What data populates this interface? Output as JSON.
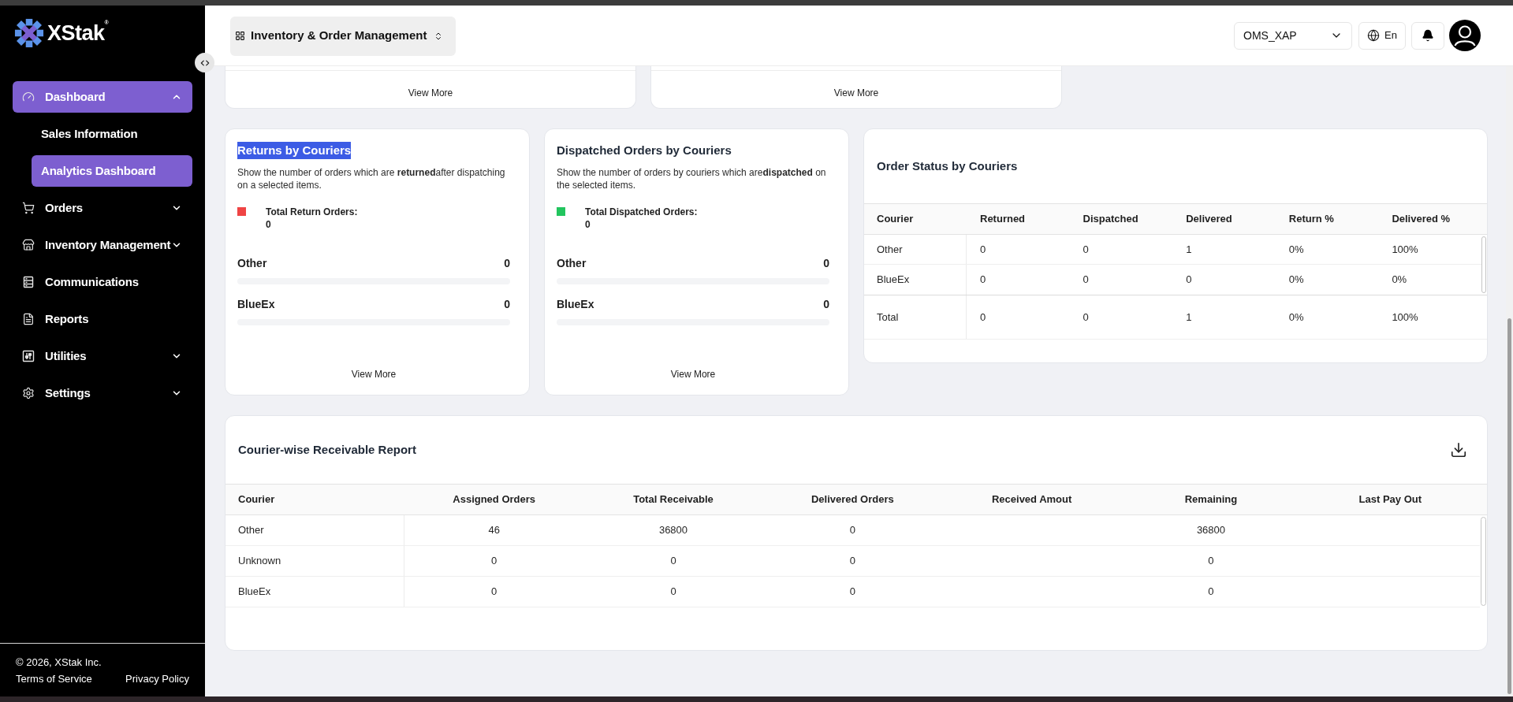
{
  "sidebar": {
    "logo": "XStak$^{®}$",
    "items": [
      {
        "kind": "group",
        "label": "Dashboard",
        "selected": true,
        "expanded": true,
        "children": [
          {
            "label": "Sales Information",
            "selected": false
          },
          {
            "label": "Analytics Dashboard",
            "selected": true
          }
        ]
      },
      {
        "kind": "group",
        "label": "Orders",
        "selected": false,
        "expanded": false
      },
      {
        "kind": "group",
        "label": "Inventory Management",
        "selected": false,
        "expanded": false
      },
      {
        "kind": "link",
        "label": "Communications",
        "selected": false
      },
      {
        "kind": "link",
        "label": "Reports",
        "selected": false
      },
      {
        "kind": "group",
        "label": "Utilities",
        "selected": false,
        "expanded": false
      },
      {
        "kind": "group",
        "label": "Settings",
        "selected": false,
        "expanded": false
      }
    ],
    "footer": {
      "copyright": "© 2026, XStak Inc.",
      "links": [
        "Terms of Service",
        "Privacy Policy"
      ]
    }
  },
  "header": {
    "app_switcher": "Inventory & Order Management",
    "store_select": "OMS_XAP",
    "language": "En"
  },
  "top_cards": [
    {
      "link": "View More"
    },
    {
      "link": "View More"
    }
  ],
  "courier_cards": [
    {
      "title": "Returns by Couriers",
      "title_highlighted": true,
      "description": "Show the number of orders which are **returned**after dispatching on a selected items.",
      "legend": {
        "label": "Total Return Orders:",
        "value": "0",
        "color": "#ef4444"
      },
      "rows": [
        {
          "name": "Other",
          "value": "0",
          "level": 0
        },
        {
          "name": "BlueEx",
          "value": "0",
          "level": 0
        }
      ],
      "link": "View More"
    },
    {
      "title": "Dispatched Orders by Couriers",
      "title_highlighted": false,
      "description": "Show the number of orders by couriers which are**dispatched** on the selected items.",
      "legend": {
        "label": "Total Dispatched Orders:",
        "value": "0",
        "color": "#22c55e"
      },
      "rows": [
        {
          "name": "Other",
          "value": "0",
          "level": 0
        },
        {
          "name": "BlueEx",
          "value": "0",
          "level": 0
        }
      ],
      "link": "View More"
    }
  ],
  "order_status": {
    "title": "Order Status by Couriers",
    "columns": [
      "Courier",
      "Returned",
      "Dispatched",
      "Delivered",
      "Return %",
      "Delivered %"
    ],
    "rows": [
      [
        "Other",
        "0",
        "0",
        "1",
        "0%",
        "100%"
      ],
      [
        "BlueEx",
        "0",
        "0",
        "0",
        "0%",
        "0%"
      ]
    ],
    "total": [
      "Total",
      "0",
      "0",
      "1",
      "0%",
      "100%"
    ]
  },
  "receivable_report": {
    "title": "Courier-wise Receivable Report",
    "columns": [
      "Courier",
      "Assigned Orders",
      "Total Receivable",
      "Delivered Orders",
      "Received Amout",
      "Remaining",
      "Last Pay Out"
    ],
    "rows": [
      {
        "courier": "Other",
        "assigned_orders": "46",
        "total_receivable": "36800",
        "delivered_orders": "0",
        "remaining": "36800"
      },
      {
        "courier": "Unknown",
        "assigned_orders": "0",
        "total_receivable": "0",
        "delivered_orders": "0",
        "remaining": "0"
      },
      {
        "courier": "BlueEx",
        "assigned_orders": "0",
        "total_receivable": "0",
        "delivered_orders": "0",
        "remaining": "0"
      }
    ]
  }
}
